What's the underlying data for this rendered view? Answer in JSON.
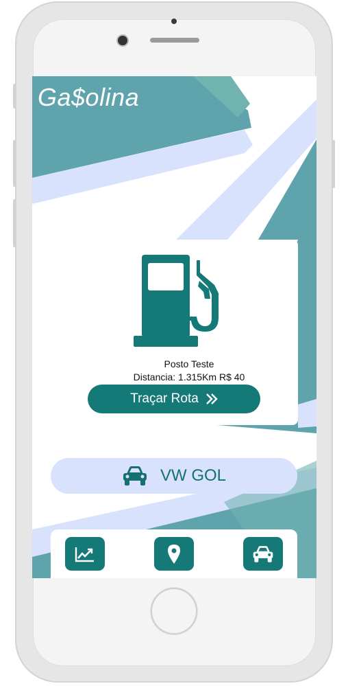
{
  "app": {
    "title": "Ga$olina"
  },
  "station": {
    "name": "Posto Teste",
    "info": "Distancia: 1.315Km R$ 40",
    "route_button_label": "Traçar Rota",
    "icon": "fuel-pump-icon"
  },
  "vehicle": {
    "label": "VW GOL",
    "icon": "car-icon"
  },
  "bottom_nav": {
    "items": [
      {
        "name": "stats",
        "icon": "trending-chart-icon"
      },
      {
        "name": "map",
        "icon": "location-pin-icon"
      },
      {
        "name": "vehicles",
        "icon": "car-icon"
      }
    ]
  },
  "colors": {
    "primary": "#157978",
    "teal_light": "#5fa4ad",
    "lavender": "#d9e2fc",
    "white": "#ffffff"
  }
}
